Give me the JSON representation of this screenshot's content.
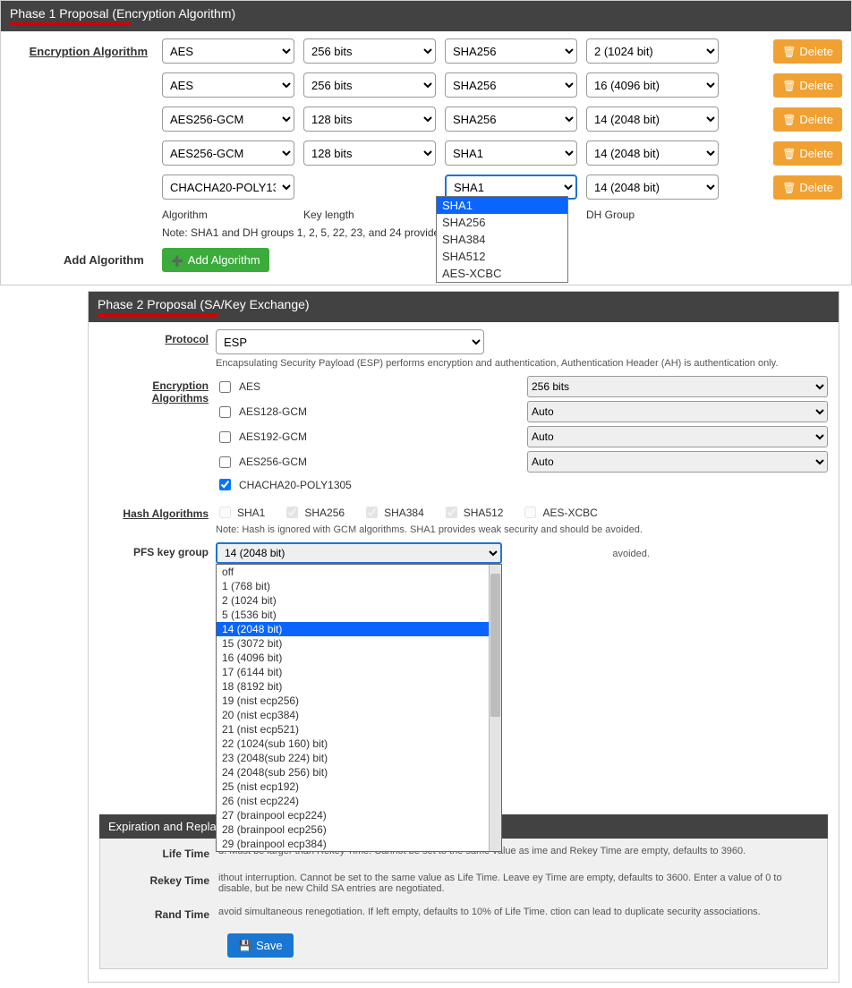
{
  "phase1": {
    "header": "Phase 1 Proposal (Encryption Algorithm)",
    "section_label": "Encryption Algorithm",
    "rows": [
      {
        "algo": "AES",
        "keylen": "256 bits",
        "hash": "SHA256",
        "dh": "2 (1024 bit)"
      },
      {
        "algo": "AES",
        "keylen": "256 bits",
        "hash": "SHA256",
        "dh": "16 (4096 bit)"
      },
      {
        "algo": "AES256-GCM",
        "keylen": "128 bits",
        "hash": "SHA256",
        "dh": "14 (2048 bit)"
      },
      {
        "algo": "AES256-GCM",
        "keylen": "128 bits",
        "hash": "SHA1",
        "dh": "14 (2048 bit)"
      },
      {
        "algo": "CHACHA20-POLY13",
        "keylen": "",
        "hash": "SHA1",
        "dh": "14 (2048 bit)"
      }
    ],
    "sub_labels": {
      "algo": "Algorithm",
      "keylen": "Key length",
      "hash": "",
      "dh": "DH Group"
    },
    "hash_dropdown_open_row": 4,
    "hash_options": [
      "SHA1",
      "SHA256",
      "SHA384",
      "SHA512",
      "AES-XCBC"
    ],
    "note": "Note: SHA1 and DH groups 1, 2, 5, 22, 23, and 24 provide weak                                               voided.",
    "delete_label": "Delete",
    "add_section_label": "Add Algorithm",
    "add_button": "Add Algorithm"
  },
  "phase2": {
    "header": "Phase 2 Proposal (SA/Key Exchange)",
    "protocol_label": "Protocol",
    "protocol_value": "ESP",
    "protocol_desc": "Encapsulating Security Payload (ESP) performs encryption and authentication, Authentication Header (AH) is authentication only.",
    "enc_label": "Encryption Algorithms",
    "enc_algorithms": [
      {
        "name": "AES",
        "checked": false,
        "keylen": "256 bits"
      },
      {
        "name": "AES128-GCM",
        "checked": false,
        "keylen": "Auto"
      },
      {
        "name": "AES192-GCM",
        "checked": false,
        "keylen": "Auto"
      },
      {
        "name": "AES256-GCM",
        "checked": false,
        "keylen": "Auto"
      },
      {
        "name": "CHACHA20-POLY1305",
        "checked": true,
        "keylen": null
      }
    ],
    "hash_label": "Hash Algorithms",
    "hash_algorithms": [
      {
        "name": "SHA1",
        "checked": false,
        "disabled": true
      },
      {
        "name": "SHA256",
        "checked": true,
        "disabled": true
      },
      {
        "name": "SHA384",
        "checked": true,
        "disabled": true
      },
      {
        "name": "SHA512",
        "checked": true,
        "disabled": true
      },
      {
        "name": "AES-XCBC",
        "checked": false,
        "disabled": true
      }
    ],
    "hash_note": "Note: Hash is ignored with GCM algorithms. SHA1 provides weak security and should be avoided.",
    "pfs_label": "PFS key group",
    "pfs_value": "14 (2048 bit)",
    "pfs_dropdown_open": true,
    "pfs_options": [
      "off",
      "1 (768 bit)",
      "2 (1024 bit)",
      "5 (1536 bit)",
      "14 (2048 bit)",
      "15 (3072 bit)",
      "16 (4096 bit)",
      "17 (6144 bit)",
      "18 (8192 bit)",
      "19 (nist ecp256)",
      "20 (nist ecp384)",
      "21 (nist ecp521)",
      "22 (1024(sub 160) bit)",
      "23 (2048(sub 224) bit)",
      "24 (2048(sub 256) bit)",
      "25 (nist ecp192)",
      "26 (nist ecp224)",
      "27 (brainpool ecp224)",
      "28 (brainpool ecp256)",
      "29 (brainpool ecp384)"
    ],
    "pfs_desc_fragment": "avoided.",
    "expiration": {
      "header": "Expiration and Replace",
      "life_label": "Life Time",
      "life_desc": "d. Must be larger than Rekey Time. Cannot be set to the same value as ime and Rekey Time are empty, defaults to 3960.",
      "rekey_label": "Rekey Time",
      "rekey_desc": "ithout interruption. Cannot be set to the same value as Life Time. Leave ey Time are empty, defaults to 3600. Enter a value of 0 to disable, but be new Child SA entries are negotiated.",
      "rand_label": "Rand Time",
      "rand_desc": "avoid simultaneous renegotiation. If left empty, defaults to 10% of Life Time. ction can lead to duplicate security associations."
    },
    "save_label": "Save"
  }
}
